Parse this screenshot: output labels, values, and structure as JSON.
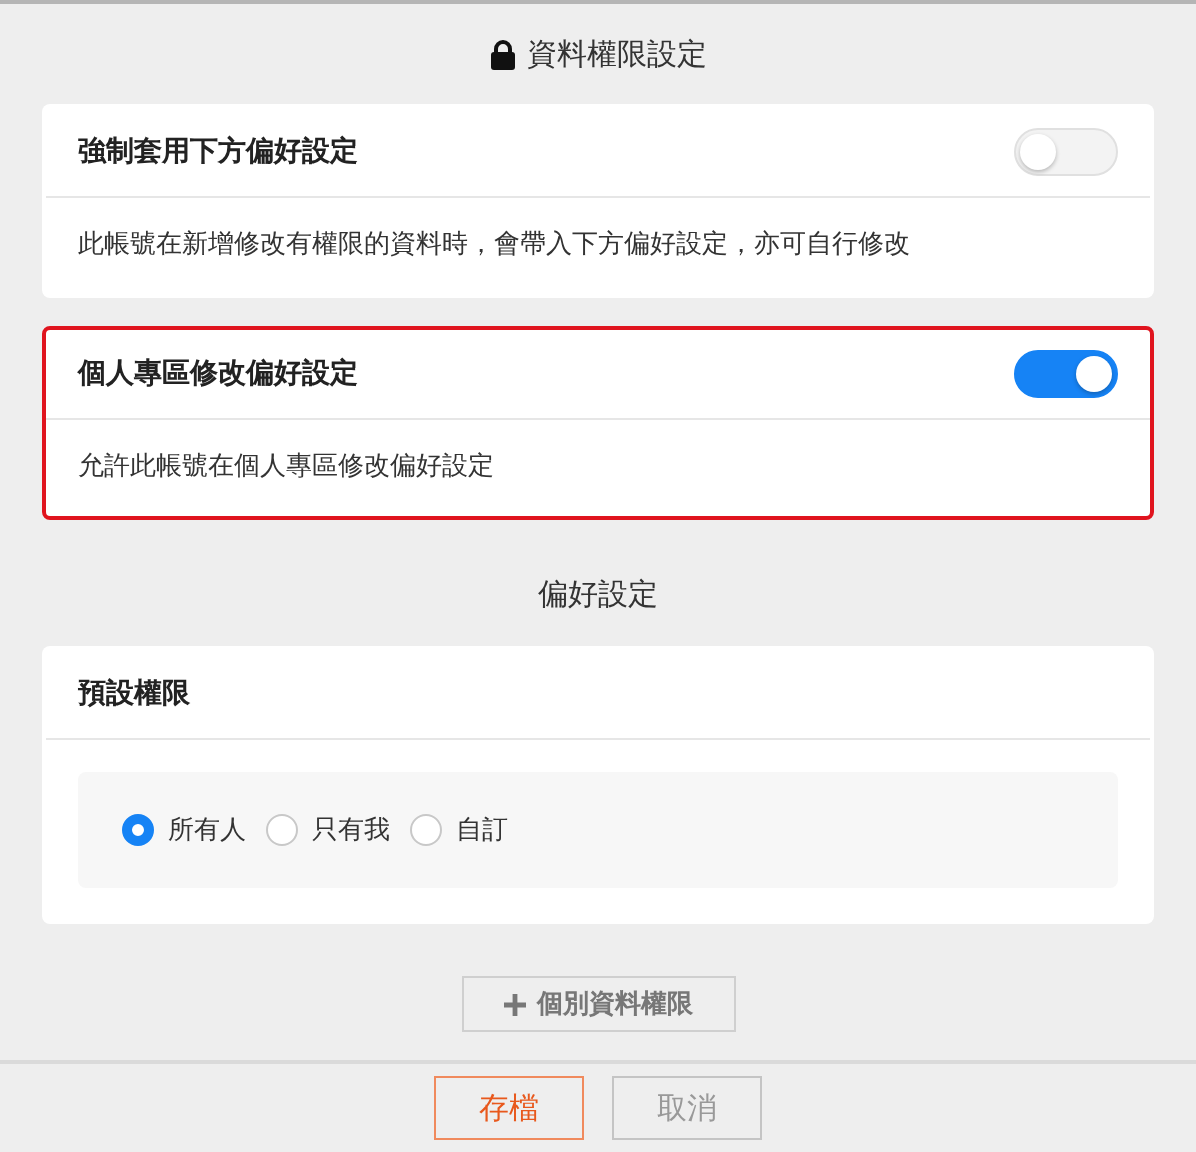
{
  "section_title": "資料權限設定",
  "cards": [
    {
      "title": "強制套用下方偏好設定",
      "on": false,
      "highlighted": false,
      "description": "此帳號在新增修改有權限的資料時，會帶入下方偏好設定，亦可自行修改"
    },
    {
      "title": "個人專區修改偏好設定",
      "on": true,
      "highlighted": true,
      "description": "允許此帳號在個人專區修改偏好設定"
    }
  ],
  "preferences": {
    "heading": "偏好設定",
    "title": "預設權限",
    "options": [
      {
        "label": "所有人",
        "selected": true
      },
      {
        "label": "只有我",
        "selected": false
      },
      {
        "label": "自訂",
        "selected": false
      }
    ]
  },
  "add_button": "個別資料權限",
  "footer": {
    "save": "存檔",
    "cancel": "取消"
  }
}
